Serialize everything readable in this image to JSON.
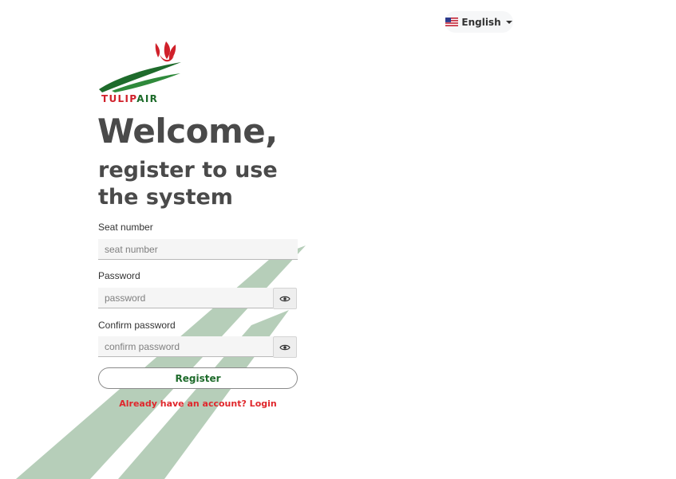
{
  "language": {
    "label": "English",
    "flag": "us-flag-icon"
  },
  "brand": {
    "name_part1": "TULIP",
    "name_part2": "AIR",
    "logo": "tulip-logo-icon"
  },
  "heading": {
    "title": "Welcome,",
    "subtitle": "register to use the system"
  },
  "form": {
    "seat": {
      "label": "Seat number",
      "placeholder": "seat number",
      "value": ""
    },
    "password": {
      "label": "Password",
      "placeholder": "password",
      "value": ""
    },
    "confirm": {
      "label": "Confirm password",
      "placeholder": "confirm password",
      "value": ""
    },
    "toggle_icon": "eye-icon",
    "register_label": "Register",
    "login_link": "Already have an account? Login"
  },
  "colors": {
    "brand_green": "#1e6b2b",
    "brand_red": "#e0272c",
    "stripe_green": "#b6ceb9",
    "heading_gray": "#4a4a4a"
  }
}
